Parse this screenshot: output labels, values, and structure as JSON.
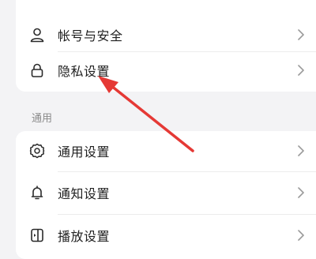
{
  "account_section": {
    "items": [
      {
        "label": "帐号与安全",
        "icon": "person-icon"
      },
      {
        "label": "隐私设置",
        "icon": "lock-icon"
      }
    ]
  },
  "general_section": {
    "header": "通用",
    "items": [
      {
        "label": "通用设置",
        "icon": "gear-icon"
      },
      {
        "label": "通知设置",
        "icon": "bell-icon"
      },
      {
        "label": "播放设置",
        "icon": "play-settings-icon"
      }
    ]
  },
  "annotation": {
    "arrow_color": "#e53935",
    "target": "隐私设置"
  },
  "colors": {
    "background": "#f3f3f5",
    "card": "#ffffff",
    "text": "#1f1f1f",
    "secondary_text": "#8a8a8a",
    "chevron": "#9a9a9a"
  }
}
